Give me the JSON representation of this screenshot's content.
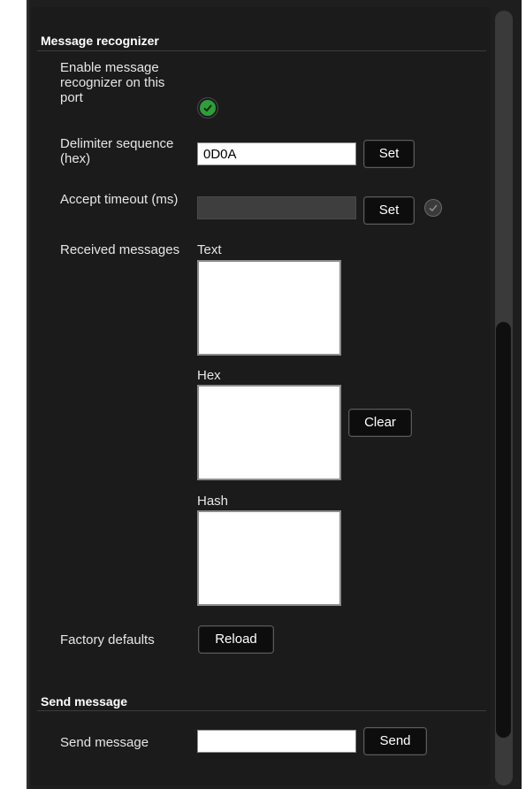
{
  "recognizer": {
    "title": "Message recognizer",
    "enable_label": "Enable message recognizer on this port",
    "delimiter_label": "Delimiter sequence (hex)",
    "delimiter_value": "0D0A",
    "delimiter_set": "Set",
    "timeout_label": "Accept timeout (ms)",
    "timeout_set": "Set",
    "received_label": "Received messages",
    "text_label": "Text",
    "hex_label": "Hex",
    "hash_label": "Hash",
    "clear_button": "Clear",
    "factory_label": "Factory defaults",
    "reload_button": "Reload"
  },
  "send": {
    "title": "Send message",
    "label": "Send message",
    "value": "",
    "button": "Send"
  },
  "colors": {
    "panel": "#1b1b1b",
    "check_green": "#2e9e3a",
    "check_grey": "#3a3a3a"
  }
}
